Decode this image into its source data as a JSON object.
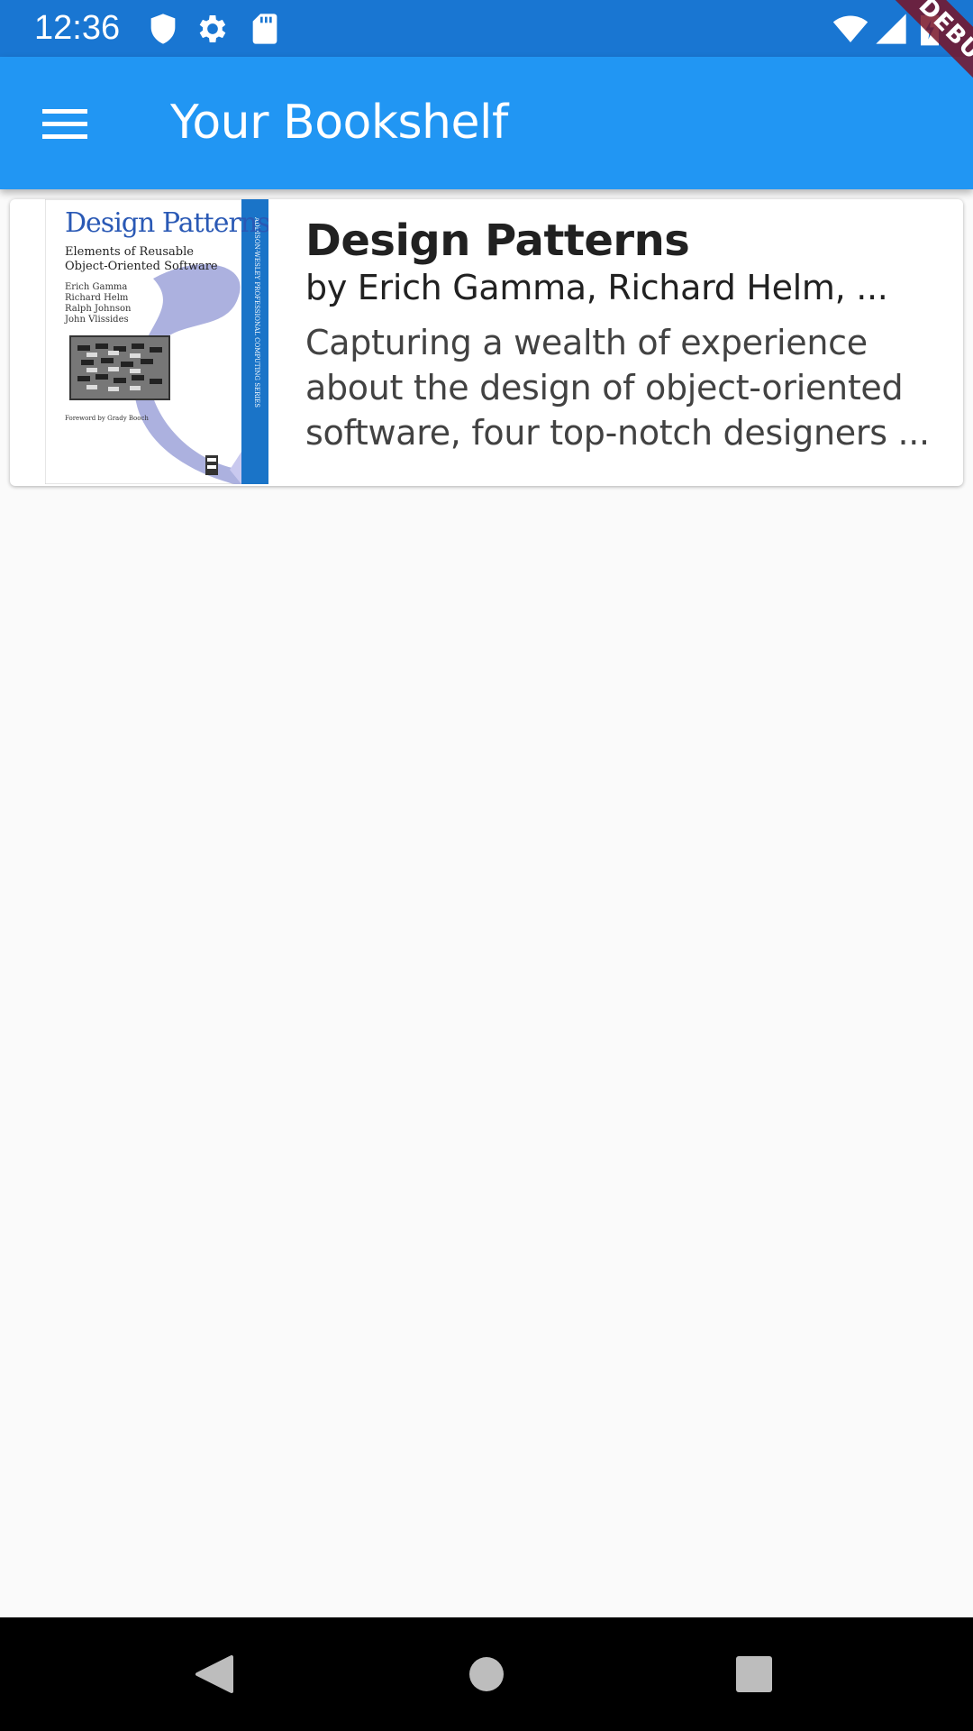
{
  "status_bar": {
    "time": "12:36",
    "icons": [
      "shield-icon",
      "gear-icon",
      "sd-card-icon",
      "wifi-icon",
      "signal-icon",
      "battery-charging-icon"
    ]
  },
  "debug_banner": {
    "label": "DEBUG",
    "color": "#7a1a30"
  },
  "app_bar": {
    "title": "Your Bookshelf",
    "menu_icon": "menu-icon",
    "background": "#2196f3"
  },
  "books": [
    {
      "title": "Design Patterns",
      "author": "by Erich Gamma, Richard Helm, ...",
      "description_lines": [
        "Capturing a wealth of experience",
        "about the design of object-oriented",
        "software, four top-notch designers ..."
      ],
      "cover": {
        "title": "Design Patterns",
        "subtitle_1": "Elements of Reusable",
        "subtitle_2": "Object-Oriented Software",
        "authors": [
          "Erich Gamma",
          "Richard Helm",
          "Ralph Johnson",
          "John Vlissides"
        ],
        "foreword": "Foreword by Grady Booch",
        "spine": "ADDISON-WESLEY PROFESSIONAL COMPUTING SERIES"
      }
    }
  ],
  "nav_bar": {
    "icons": [
      "back-icon",
      "home-icon",
      "recents-icon"
    ]
  }
}
